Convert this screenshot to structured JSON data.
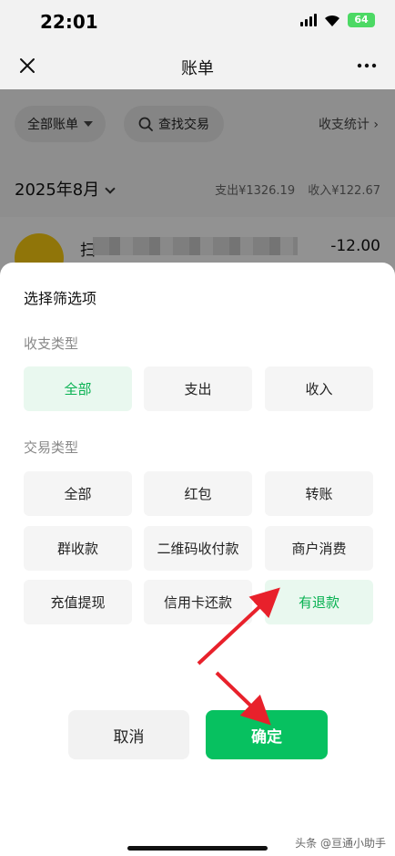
{
  "status_bar": {
    "time": "22:01",
    "battery": "64"
  },
  "nav": {
    "title": "账单"
  },
  "filters": {
    "all_bills": "全部账单",
    "search": "查找交易",
    "stats": "收支统计 ›"
  },
  "month": {
    "label": "2025年8月",
    "expense": "支出¥1326.19",
    "income": "收入¥122.67"
  },
  "transaction": {
    "name_prefix": "扫",
    "amount": "-12.00"
  },
  "sheet": {
    "title": "选择筛选项",
    "section_income_type": "收支类型",
    "income_type_options": [
      "全部",
      "支出",
      "收入"
    ],
    "section_txn_type": "交易类型",
    "txn_type_options": [
      "全部",
      "红包",
      "转账",
      "群收款",
      "二维码收付款",
      "商户消费",
      "充值提现",
      "信用卡还款",
      "有退款"
    ],
    "cancel": "取消",
    "confirm": "确定"
  },
  "watermark": "头条 @亘通小助手",
  "colors": {
    "accent": "#07c160",
    "selected_bg": "#e9f8ef",
    "arrow": "#e8212b"
  }
}
